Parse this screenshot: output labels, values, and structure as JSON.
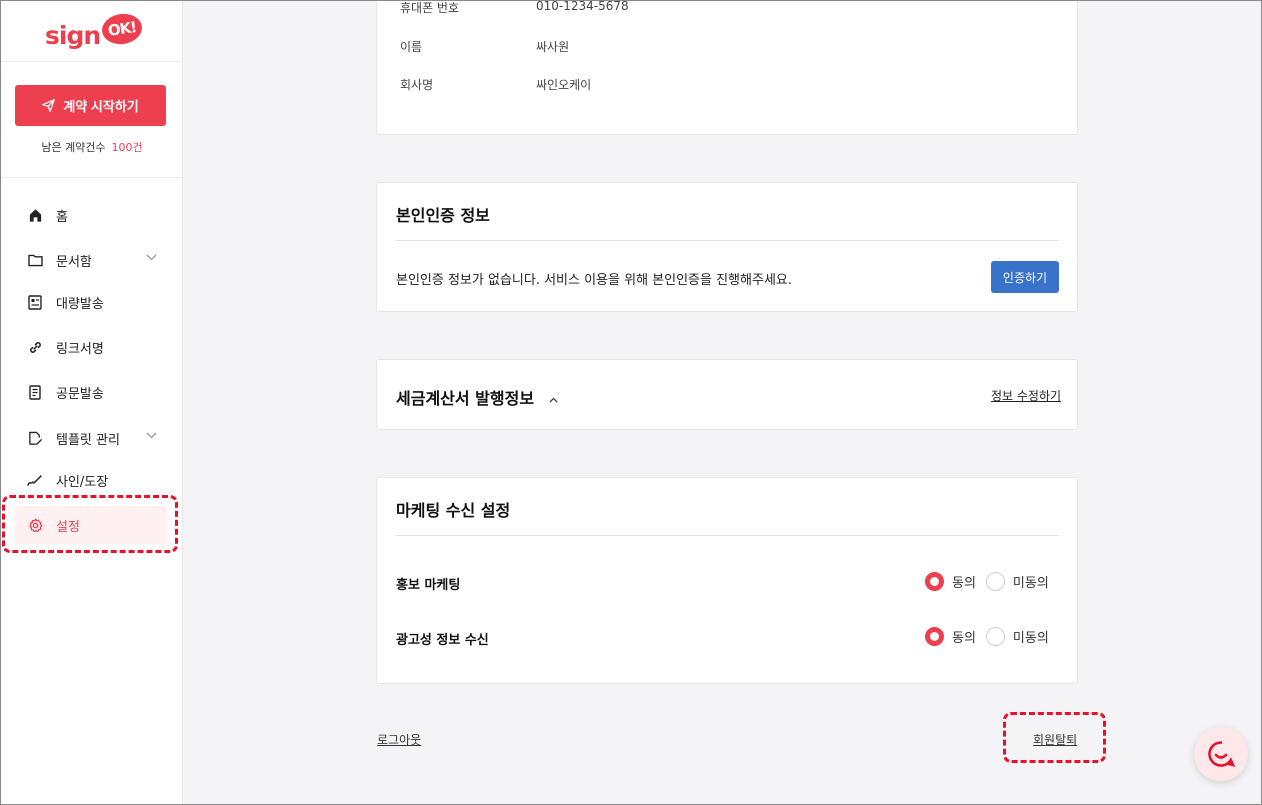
{
  "logo": {
    "text": "sign",
    "badge": "OK!"
  },
  "sidebar": {
    "start_button": "계약 시작하기",
    "remaining_label": "남은 계약건수",
    "remaining_count": "100건",
    "items": [
      {
        "label": "홈",
        "icon": "home-icon"
      },
      {
        "label": "문서함",
        "icon": "folder-icon",
        "expandable": true
      },
      {
        "label": "대량발송",
        "icon": "bulk-send-icon"
      },
      {
        "label": "링크서명",
        "icon": "link-icon"
      },
      {
        "label": "공문발송",
        "icon": "document-icon"
      },
      {
        "label": "템플릿 관리",
        "icon": "template-edit-icon",
        "expandable": true
      },
      {
        "label": "사인/도장",
        "icon": "signature-icon"
      },
      {
        "label": "설정",
        "icon": "gear-icon",
        "active": true
      }
    ]
  },
  "profile": {
    "rows": [
      {
        "label": "휴대폰 번호",
        "value": "010-1234-5678"
      },
      {
        "label": "이름",
        "value": "싸사원"
      },
      {
        "label": "회사명",
        "value": "싸인오케이"
      }
    ]
  },
  "verification": {
    "title": "본인인증 정보",
    "message": "본인인증 정보가 없습니다. 서비스 이용을 위해 본인인증을 진행해주세요.",
    "button": "인증하기"
  },
  "tax_invoice": {
    "title": "세금계산서 발행정보",
    "edit_link": "정보 수정하기"
  },
  "marketing": {
    "title": "마케팅 수신 설정",
    "rows": [
      {
        "label": "홍보 마케팅",
        "agree": "동의",
        "disagree": "미동의",
        "selected": "agree"
      },
      {
        "label": "광고성 정보 수신",
        "agree": "동의",
        "disagree": "미동의",
        "selected": "agree"
      }
    ]
  },
  "footer": {
    "logout": "로그아웃",
    "withdraw": "회원탈퇴"
  },
  "colors": {
    "brand": "#ee3f4e",
    "primary_button": "#3872c9",
    "highlight": "#e8102a"
  }
}
